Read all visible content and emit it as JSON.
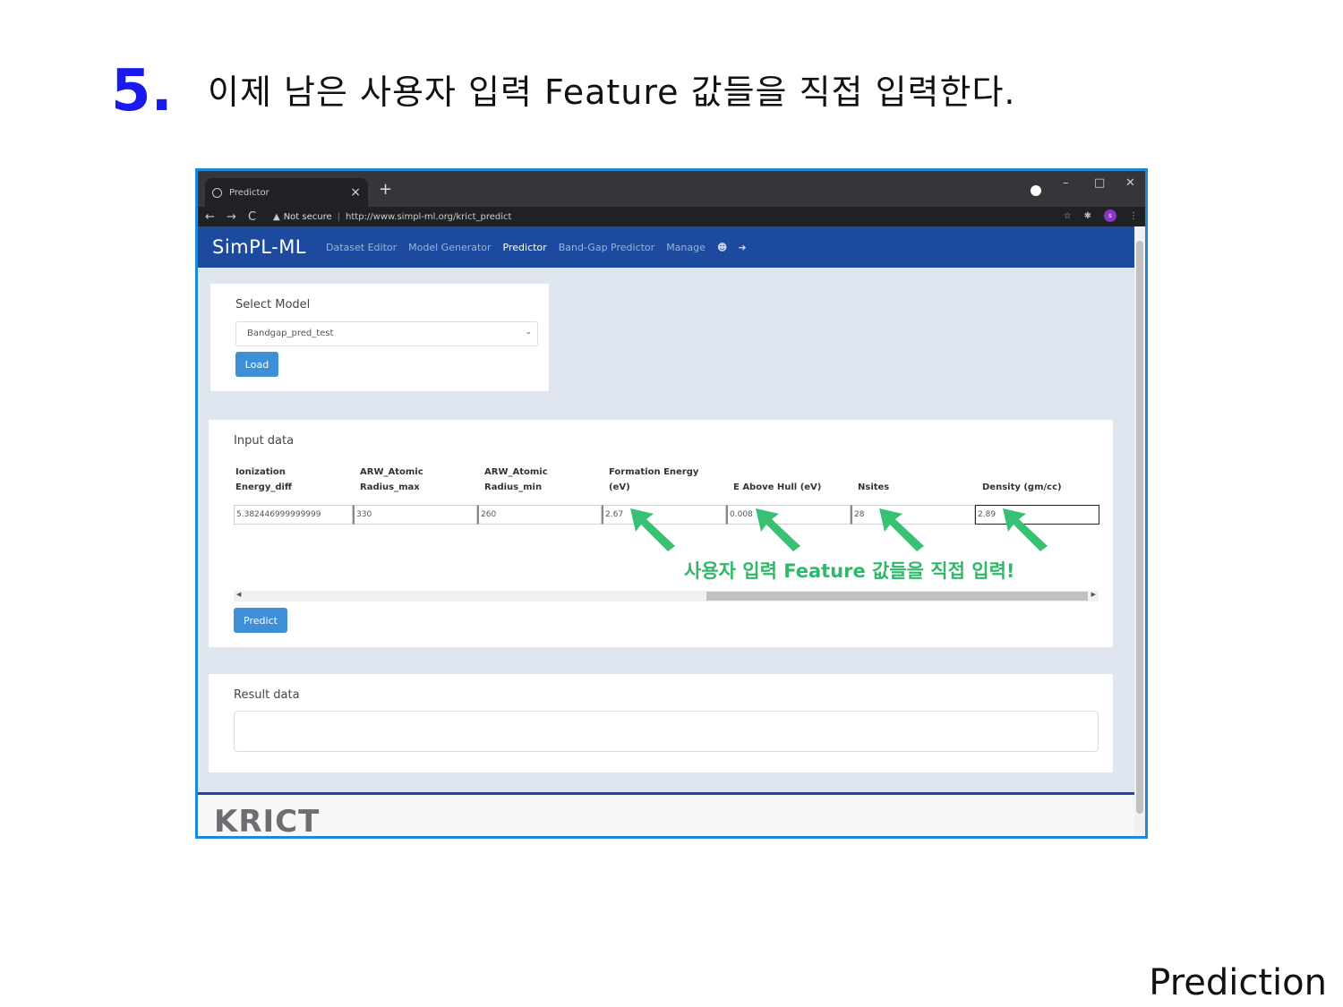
{
  "slide": {
    "step_number": "5.",
    "title": "이제 남은 사용자 입력 Feature 값들을 직접 입력한다.",
    "footer_label": "Prediction"
  },
  "browser": {
    "tab_title": "Predictor",
    "tab_close": "×",
    "new_tab": "+",
    "window_controls": [
      "–",
      "□",
      "✕"
    ],
    "nav": {
      "back": "←",
      "forward": "→",
      "reload": "C"
    },
    "security_label": "Not secure",
    "url": "http://www.simpl-ml.org/krict_predict",
    "star": "☆",
    "avatar_letter": "s"
  },
  "app": {
    "brand": "SimPL-ML",
    "nav_items": [
      {
        "label": "Dataset Editor",
        "active": false
      },
      {
        "label": "Model Generator",
        "active": false
      },
      {
        "label": "Predictor",
        "active": true
      },
      {
        "label": "Band-Gap Predictor",
        "active": false
      },
      {
        "label": "Manage",
        "active": false
      }
    ],
    "select_model": {
      "title": "Select Model",
      "selected": "Bandgap_pred_test",
      "load_label": "Load"
    },
    "input_data": {
      "title": "Input data",
      "columns": [
        {
          "line1": "Ionization",
          "line2": "Energy_diff",
          "value": "5.382446999999999"
        },
        {
          "line1": "ARW_Atomic",
          "line2": "Radius_max",
          "value": "330"
        },
        {
          "line1": "ARW_Atomic",
          "line2": "Radius_min",
          "value": "260"
        },
        {
          "line1": "Formation Energy",
          "line2": "(eV)",
          "value": "2.67"
        },
        {
          "line1": "",
          "line2": "E Above Hull (eV)",
          "value": "0.008"
        },
        {
          "line1": "",
          "line2": "Nsites",
          "value": "28"
        },
        {
          "line1": "",
          "line2": "Density (gm/cc)",
          "value": "2.89"
        }
      ],
      "predict_label": "Predict"
    },
    "result_data": {
      "title": "Result data"
    },
    "footer_logo": "KRICT",
    "accent": "#1c4a9e",
    "button_color": "#3e8fd8"
  },
  "annotation": {
    "text": "사용자 입력 Feature 값들을 직접 입력!",
    "color": "#2fb86a"
  }
}
